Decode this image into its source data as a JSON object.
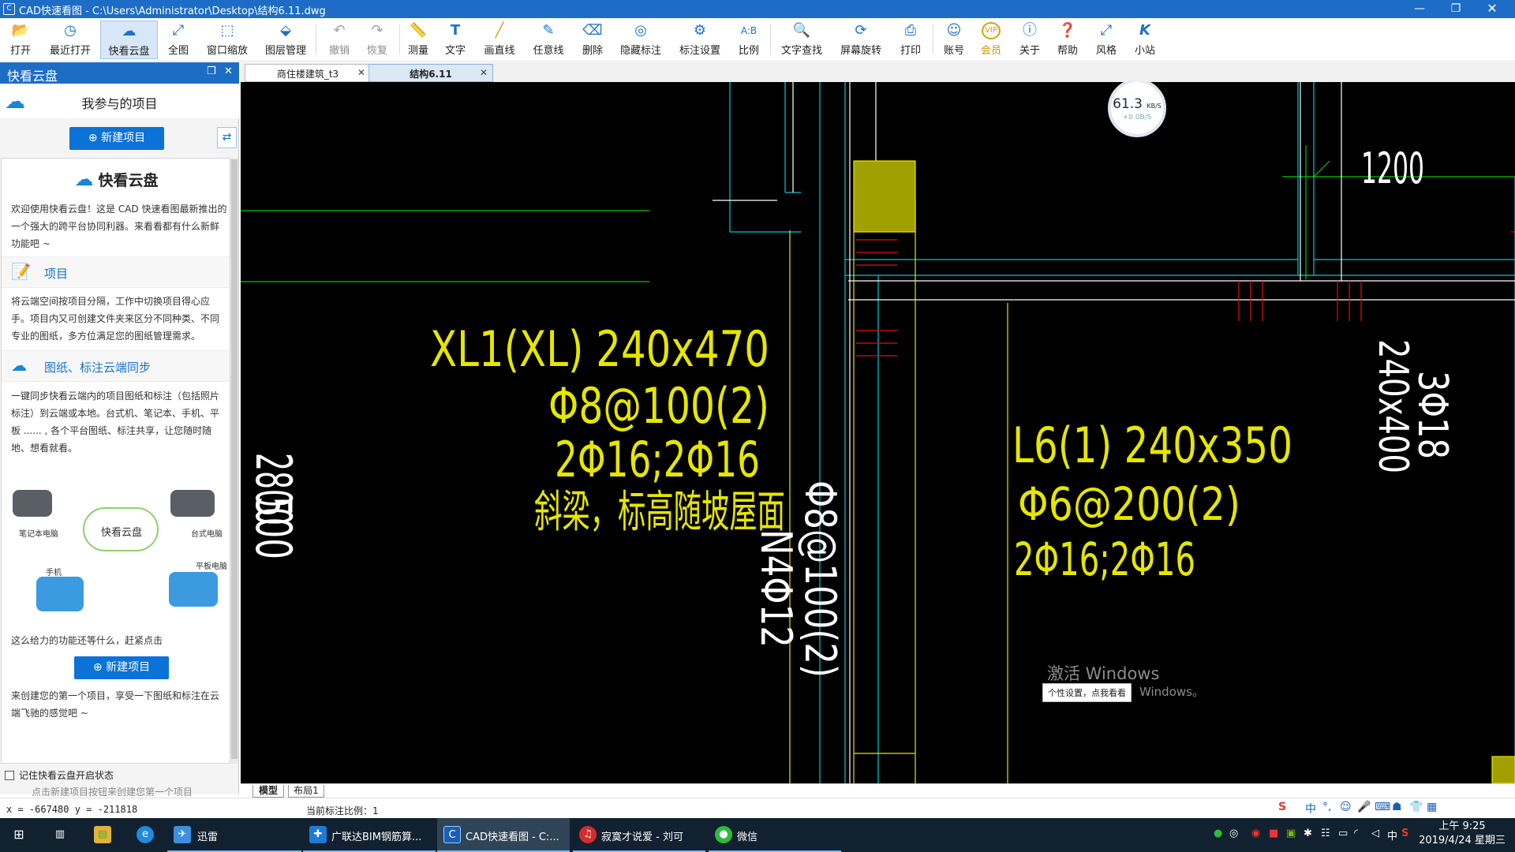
{
  "window": {
    "title": "CAD快速看图 - C:\\Users\\Administrator\\Desktop\\结构6.11.dwg",
    "app_icon": "cad-logo-icon",
    "controls": [
      "minimize-icon",
      "restore-icon",
      "close-icon"
    ]
  },
  "toolbar": {
    "items": [
      {
        "label": "打开",
        "icon": "folder-open-icon"
      },
      {
        "label": "最近打开",
        "icon": "clock-icon"
      },
      {
        "label": "快看云盘",
        "icon": "cloud-icon"
      },
      {
        "label": "全图",
        "icon": "fit-all-icon"
      },
      {
        "label": "窗口缩放",
        "icon": "window-zoom-icon"
      },
      {
        "label": "图层管理",
        "icon": "layers-icon"
      },
      {
        "label": "撤销",
        "icon": "undo-icon"
      },
      {
        "label": "恢复",
        "icon": "redo-icon"
      },
      {
        "label": "测量",
        "icon": "ruler-icon"
      },
      {
        "label": "文字",
        "icon": "text-icon"
      },
      {
        "label": "画直线",
        "icon": "line-icon"
      },
      {
        "label": "任意线",
        "icon": "pencil-icon"
      },
      {
        "label": "删除",
        "icon": "eraser-icon"
      },
      {
        "label": "隐藏标注",
        "icon": "eye-hide-icon"
      },
      {
        "label": "标注设置",
        "icon": "annotation-settings-icon"
      },
      {
        "label": "比例",
        "icon": "scale-icon"
      },
      {
        "label": "文字查找",
        "icon": "text-search-icon"
      },
      {
        "label": "屏幕旋转",
        "icon": "rotate-screen-icon"
      },
      {
        "label": "打印",
        "icon": "printer-icon"
      },
      {
        "label": "账号",
        "icon": "user-icon"
      },
      {
        "label": "会员",
        "icon": "vip-icon"
      },
      {
        "label": "关于",
        "icon": "info-icon"
      },
      {
        "label": "帮助",
        "icon": "help-icon"
      },
      {
        "label": "风格",
        "icon": "style-icon"
      },
      {
        "label": "小站",
        "icon": "site-k-icon"
      }
    ],
    "vip_text": "VIP"
  },
  "panel": {
    "title": "快看云盘",
    "subtitle": "我参与的项目",
    "new_project": "新建项目",
    "intro_title": "快看云盘",
    "intro_text": "欢迎使用快看云盘！这是 CAD 快速看图最新推出的一个强大的跨平台协同利器。来看看都有什么新鲜功能吧 ~",
    "section1_title": "项目",
    "section1_text": "将云端空间按项目分隔，工作中切换项目得心应手。项目内又可创建文件夹来区分不同种类、不同专业的图纸，多方位满足您的图纸管理需求。",
    "section2_title": "图纸、标注云端同步",
    "section2_text": "一键同步快看云端内的项目图纸和标注（包括照片标注）到云端或本地。台式机、笔记本、手机、平板 ...... , 各个平台图纸、标注共享，让您随时随地、想看就看。",
    "devices": {
      "laptop": "笔记本电脑",
      "center": "快看云盘",
      "desktop": "台式电脑",
      "phone": "手机",
      "tablet": "平板电脑"
    },
    "cta_text": "这么给力的功能还等什么，赶紧点击",
    "cta_button": "新建项目",
    "footer_text": "来创建您的第一个项目，享受一下图纸和标注在云端飞驰的感觉吧 ~",
    "remember": "记住快看云盘开启状态",
    "hint": "点击新建项目按钮来创建您第一个项目"
  },
  "tabs": [
    {
      "label": "商住楼建筑_t3",
      "active": false
    },
    {
      "label": "结构6.11",
      "active": true
    }
  ],
  "drawing": {
    "texts": {
      "dim500": "500",
      "dim2800": "2800",
      "beam1_name": "XL1(XL) 240x470",
      "beam1_stirrup": "Φ8@100(2)",
      "beam1_bars": "2Φ16;2Φ16",
      "beam1_note": "斜梁，标高随坡屋面",
      "vert_stirrup": "Φ8@100(2)",
      "vert_bars": "N4Φ12",
      "beam2_name": "L6(1) 240x350",
      "beam2_stirrup": "Φ6@200(2)",
      "beam2_bars": "2Φ16;2Φ16",
      "col_size": "240x400",
      "col_bars": "3Φ18",
      "dim1200": "1200"
    },
    "colors": {
      "yellow": "#e6e600",
      "cyan": "#00c8d8",
      "green": "#00c800",
      "red": "#e01010",
      "white": "#ffffff",
      "fill": "#a0a000"
    }
  },
  "network_widget": {
    "value": "61.3",
    "unit": "KB/S",
    "sub": "+0.0B/S"
  },
  "watermark": {
    "line1": "激活 Windows",
    "line2": "Windows。"
  },
  "tooltip": "个性设置，点我看看",
  "layouts": [
    {
      "label": "模型",
      "active": true
    },
    {
      "label": "布局1",
      "active": false
    }
  ],
  "status": {
    "coords": "x = -667480  y = -211818",
    "scale": "当前标注比例：1"
  },
  "ime": {
    "items": [
      "S",
      "中",
      "°,",
      "☺",
      "🎤",
      "⌨",
      "☗",
      "👕",
      "▦"
    ]
  },
  "taskbar": {
    "apps": [
      {
        "label": "",
        "icon": "windows-start-icon"
      },
      {
        "label": "",
        "icon": "task-view-icon"
      },
      {
        "label": "",
        "icon": "file-explorer-icon"
      },
      {
        "label": "",
        "icon": "ie-icon"
      },
      {
        "label": "迅雷",
        "icon": "xunlei-icon"
      },
      {
        "label": "广联达BIM钢筋算...",
        "icon": "glodon-icon"
      },
      {
        "label": "CAD快速看图 - C:...",
        "icon": "cad-app-icon"
      },
      {
        "label": "寂寞才说爱 - 刘可",
        "icon": "netease-music-icon"
      },
      {
        "label": "微信",
        "icon": "wechat-icon"
      }
    ],
    "tray_icons": [
      "wechat-tray-icon",
      "chat-tray-icon",
      "netease-tray-icon",
      "flash-tray-icon",
      "nvidia-tray-icon",
      "bluetooth-tray-icon",
      "network-tray-icon",
      "battery-tray-icon",
      "wifi-tray-icon",
      "volume-tray-icon",
      "ime-tray-icon",
      "sogou-tray-icon"
    ],
    "ime_tray": "中",
    "time": "上午 9:25",
    "date": "2019/4/24 星期三"
  }
}
